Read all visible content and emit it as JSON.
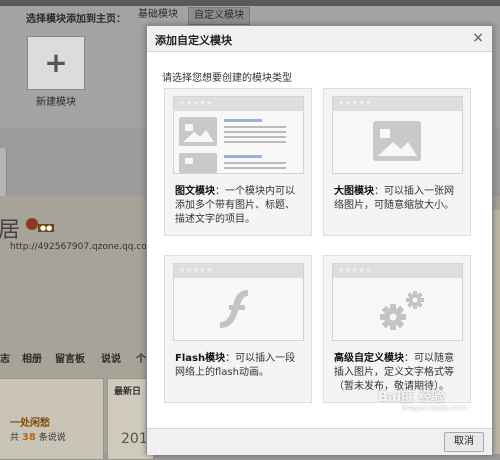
{
  "background": {
    "toolbar_label": "选择模块添加到主页：",
    "tabs": [
      "基础模块",
      "自定义模块"
    ],
    "new_module_label": "新建模块",
    "blog_title_char": "居",
    "url": "http://492567907.qzone.qq.com",
    "nav_items": [
      "志",
      "相册",
      "留言板",
      "说说",
      "个"
    ],
    "left_panel": {
      "title": "一处闲愁",
      "count_prefix": "共",
      "count": "38",
      "count_suffix": "条说说"
    },
    "right_panel": {
      "title": "最新日",
      "year": "201"
    }
  },
  "dialog": {
    "title": "添加自定义模块",
    "close_symbol": "×",
    "prompt": "请选择您想要创建的模块类型",
    "preview_stars": "×××××",
    "cards": [
      {
        "name": "图文模块",
        "desc": "：一个模块内可以添加多个带有图片、标题、描述文字的项目。"
      },
      {
        "name": "大图模块",
        "desc": "：可以插入一张网络图片，可随意缩放大小。"
      },
      {
        "name": "Flash模块",
        "desc": "：可以插入一段网络上的flash动画。"
      },
      {
        "name": "高级自定义模块",
        "desc": "：可以随意插入图片，定义文字格式等（暂未发布，敬请期待）。"
      }
    ],
    "cancel_label": "取消"
  },
  "watermark": {
    "main": "Bai度 经验",
    "sub": "jingyan.baidu.com"
  },
  "colors": {
    "dialog_header": "#f0f0f0",
    "card_bg": "#f4f4f4",
    "preview_gray": "#c9c9c9",
    "link_blue": "#4a90d9",
    "overlay": "#9a9a9a"
  }
}
